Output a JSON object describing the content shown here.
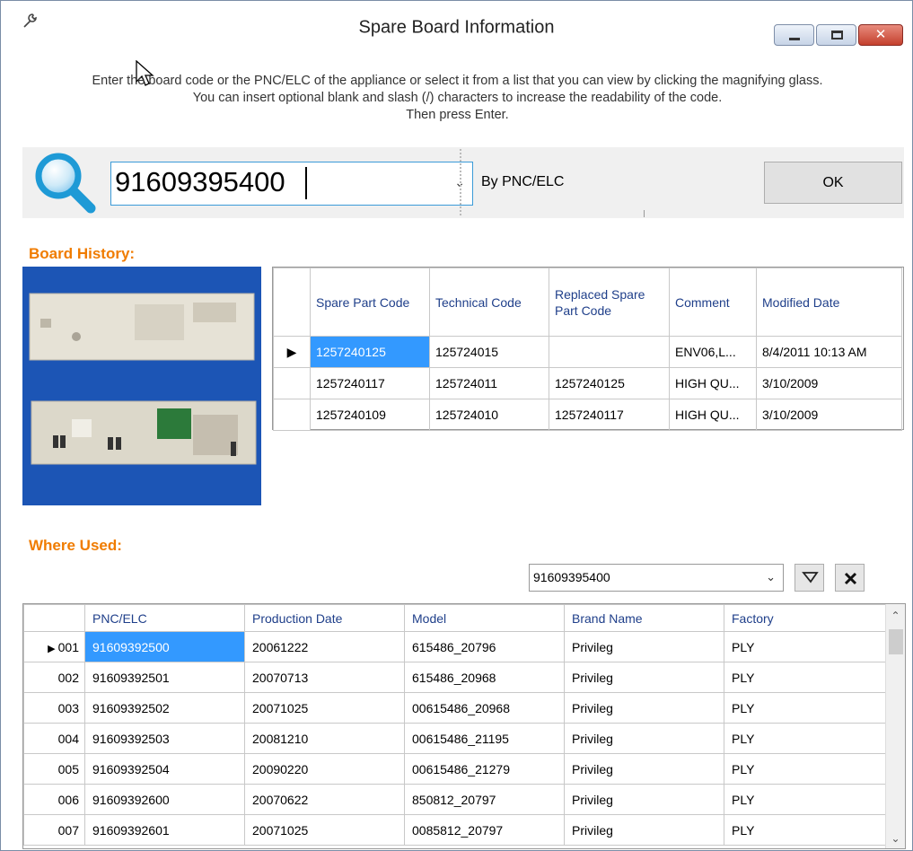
{
  "window": {
    "title": "Spare Board Information"
  },
  "instructions": {
    "line1": "Enter the board code or the PNC/ELC of the appliance or select it from a list that you can view by clicking the magnifying glass.",
    "line2": "You can insert optional blank and slash (/) characters to increase the readability of the code.",
    "line3": "Then press Enter."
  },
  "search": {
    "value": "91609395400",
    "mode_label": "By PNC/ELC",
    "ok_label": "OK"
  },
  "board_history": {
    "title": "Board History:",
    "columns": [
      "Spare Part Code",
      "Technical Code",
      "Replaced Spare Part Code",
      "Comment",
      "Modified Date"
    ],
    "rows": [
      [
        "1257240125",
        "125724015",
        "",
        "ENV06,L...",
        "8/4/2011 10:13 AM"
      ],
      [
        "1257240117",
        "125724011",
        "1257240125",
        "HIGH QU...",
        "3/10/2009"
      ],
      [
        "1257240109",
        "125724010",
        "1257240117",
        "HIGH QU...",
        "3/10/2009"
      ]
    ]
  },
  "where_used": {
    "title": "Where Used:",
    "filter_value": "91609395400",
    "columns": [
      "PNC/ELC",
      "Production Date",
      "Model",
      "Brand Name",
      "Factory"
    ],
    "rows": [
      [
        "001",
        "91609392500",
        "20061222",
        "615486_20796",
        "Privileg",
        "PLY"
      ],
      [
        "002",
        "91609392501",
        "20070713",
        "615486_20968",
        "Privileg",
        "PLY"
      ],
      [
        "003",
        "91609392502",
        "20071025",
        "00615486_20968",
        "Privileg",
        "PLY"
      ],
      [
        "004",
        "91609392503",
        "20081210",
        "00615486_21195",
        "Privileg",
        "PLY"
      ],
      [
        "005",
        "91609392504",
        "20090220",
        "00615486_21279",
        "Privileg",
        "PLY"
      ],
      [
        "006",
        "91609392600",
        "20070622",
        "850812_20797",
        "Privileg",
        "PLY"
      ],
      [
        "007",
        "91609392601",
        "20071025",
        "0085812_20797",
        "Privileg",
        "PLY"
      ]
    ]
  },
  "colors": {
    "accent_orange": "#f07c00",
    "selection_blue": "#3399ff",
    "header_text": "#1f3f8a",
    "board_bg": "#1c55b5"
  },
  "icons": [
    "wrench-icon",
    "minimize-icon",
    "maximize-icon",
    "close-icon",
    "magnifier-icon",
    "dropdown-arrow-icon",
    "filter-icon",
    "clear-filter-icon",
    "row-pointer-icon",
    "scroll-up-icon",
    "scroll-down-icon"
  ]
}
